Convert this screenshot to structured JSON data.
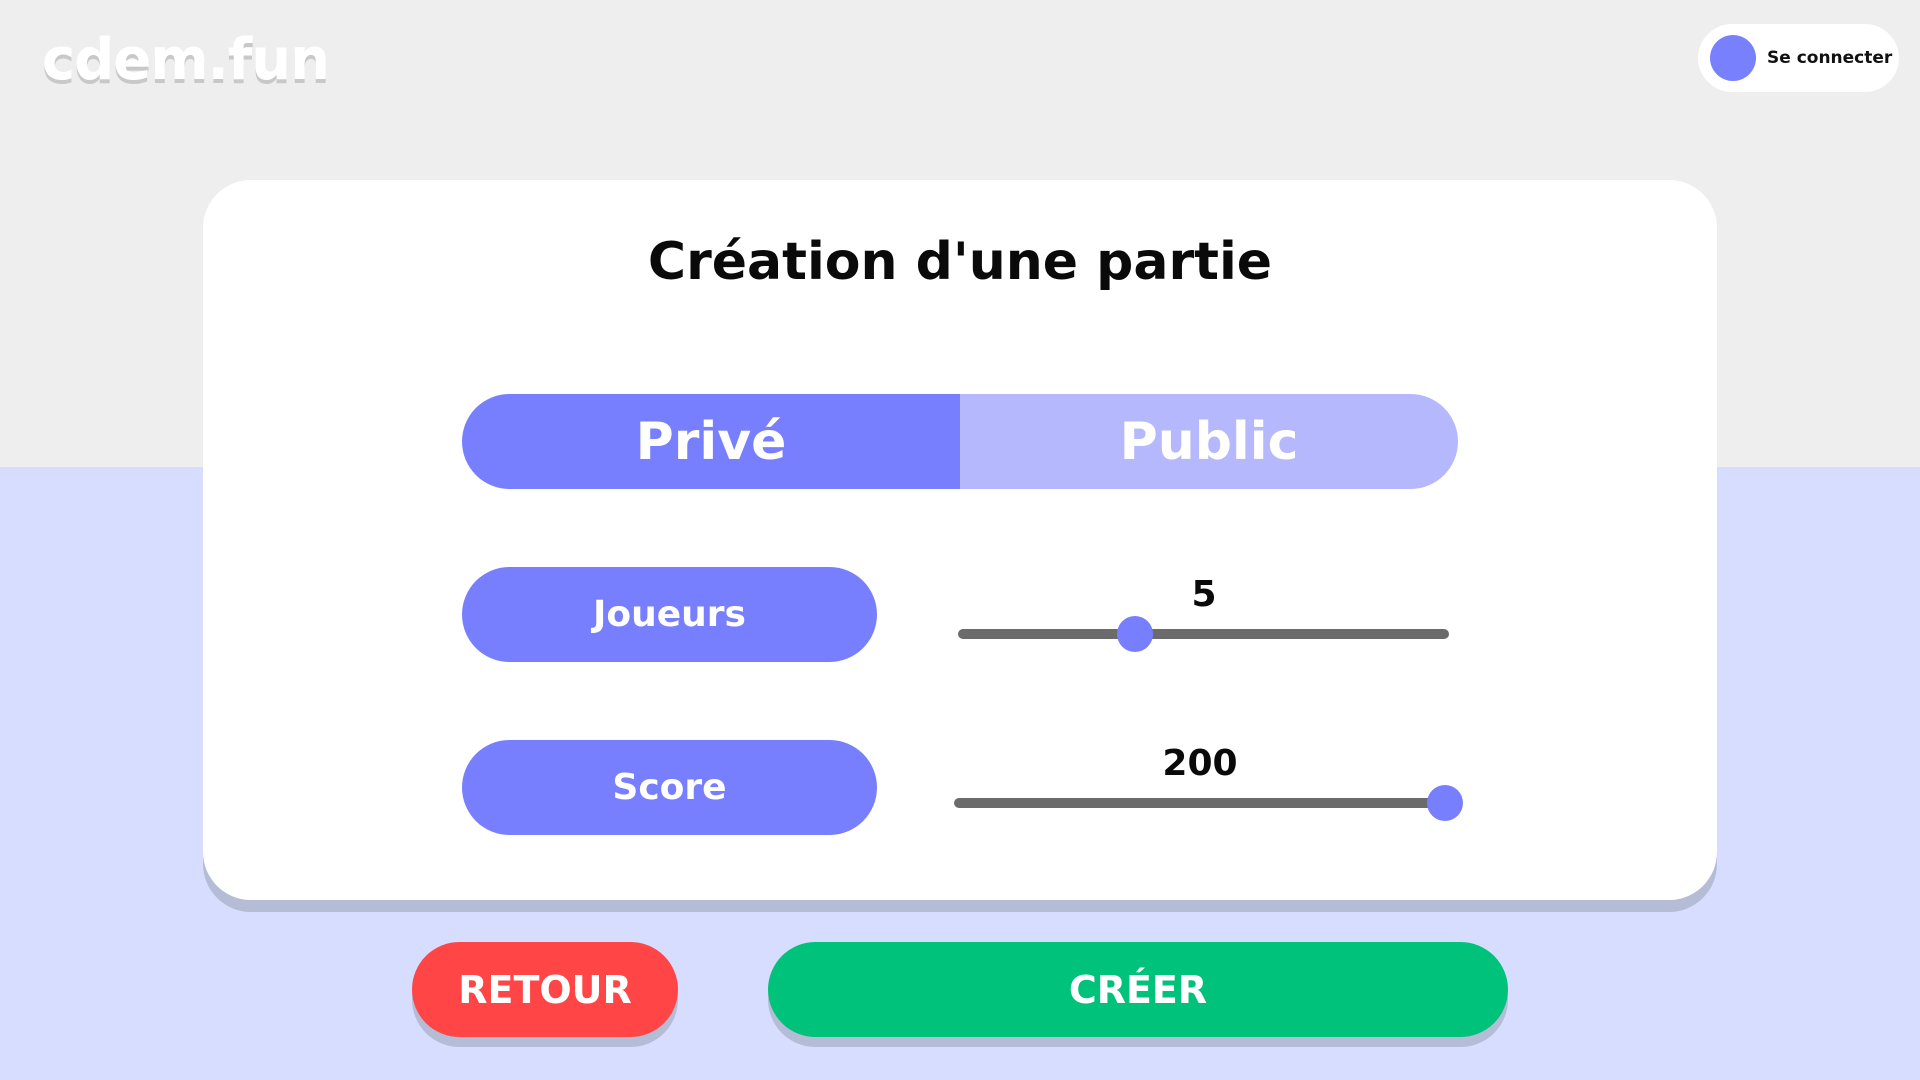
{
  "header": {
    "logo": "cdem.fun",
    "login_label": "Se connecter"
  },
  "card": {
    "title": "Création d'une partie",
    "visibility": {
      "options": [
        "Privé",
        "Public"
      ],
      "selected": "Privé"
    },
    "players": {
      "label": "Joueurs",
      "value": "5",
      "slider_fraction": 0.36
    },
    "score": {
      "label": "Score",
      "value": "200",
      "slider_fraction": 0.98
    }
  },
  "actions": {
    "back_label": "RETOUR",
    "create_label": "CRÉER"
  },
  "colors": {
    "accent": "#787ffe",
    "accent_light": "#b5b8fd",
    "danger": "#ff4545",
    "success": "#00c27b",
    "background_top": "#eeeeee",
    "background_bottom": "#d6ddfe"
  }
}
